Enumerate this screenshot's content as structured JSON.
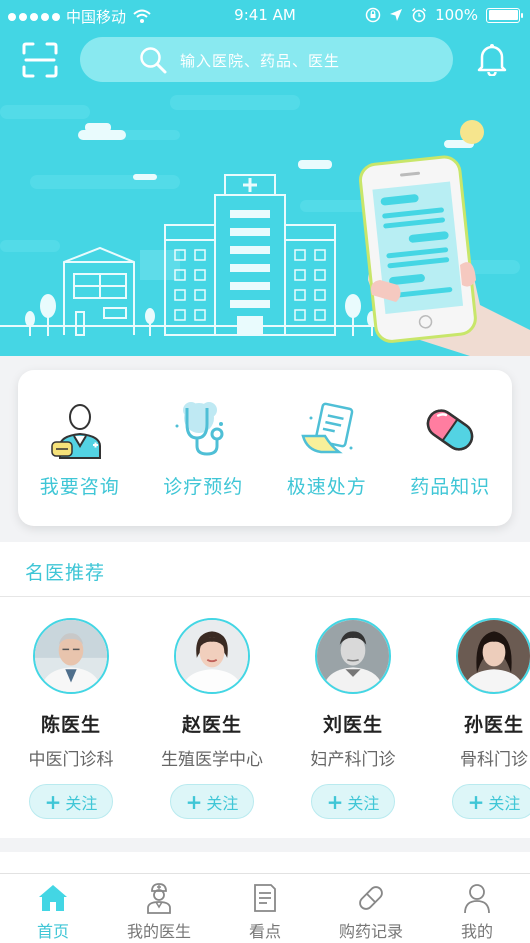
{
  "status_bar": {
    "carrier": "中国移动",
    "time": "9:41 AM",
    "battery": "100%"
  },
  "header": {
    "search_placeholder": "输入医院、药品、医生"
  },
  "quick_actions": [
    {
      "label": "我要咨询",
      "icon": "doctor-consult-icon"
    },
    {
      "label": "诊疗预约",
      "icon": "stethoscope-icon"
    },
    {
      "label": "极速处方",
      "icon": "prescription-icon"
    },
    {
      "label": "药品知识",
      "icon": "capsule-icon"
    }
  ],
  "recommended": {
    "title": "名医推荐",
    "follow_label": "关注",
    "doctors": [
      {
        "name": "陈医生",
        "department": "中医门诊科"
      },
      {
        "name": "赵医生",
        "department": "生殖医学中心"
      },
      {
        "name": "刘医生",
        "department": "妇产科门诊"
      },
      {
        "name": "孙医生",
        "department": "骨科门诊"
      }
    ]
  },
  "tabs": [
    {
      "label": "首页",
      "icon": "home-icon",
      "active": true
    },
    {
      "label": "我的医生",
      "icon": "my-doctor-icon",
      "active": false
    },
    {
      "label": "看点",
      "icon": "article-icon",
      "active": false
    },
    {
      "label": "购药记录",
      "icon": "pill-icon",
      "active": false
    },
    {
      "label": "我的",
      "icon": "profile-icon",
      "active": false
    }
  ],
  "colors": {
    "primary": "#43d6e4",
    "accent_text": "#3fc6d6",
    "pill_pink": "#ff7da0"
  }
}
